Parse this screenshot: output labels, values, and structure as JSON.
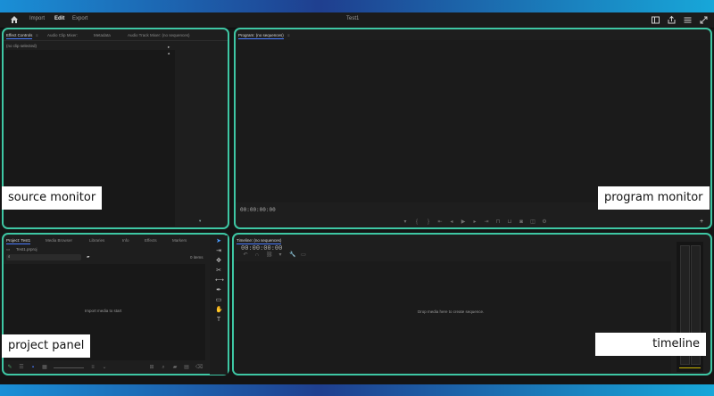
{
  "menubar": {
    "items": [
      {
        "label": "Import",
        "active": false
      },
      {
        "label": "Edit",
        "active": true
      },
      {
        "label": "Export",
        "active": false
      }
    ],
    "title": "Test1"
  },
  "source_panel": {
    "tabs": [
      "Effect Controls",
      "Audio Clip Mixer:",
      "Metadata",
      "Audio Track Mixer: (no sequences)"
    ],
    "no_clip": "(no clip selected)"
  },
  "program_panel": {
    "title": "Program: (no sequences)",
    "timecode": "00:00:00:00"
  },
  "project_panel": {
    "tabs": [
      "Project: Test1",
      "Media Browser",
      "Libraries",
      "Info",
      "Effects",
      "Markers"
    ],
    "project_name": "Test1.prproj",
    "item_count": "0 items",
    "empty_message": "Import media to start"
  },
  "timeline_panel": {
    "title": "Timeline: (no sequences)",
    "timecode": "00:00:00:00",
    "empty_message": "Drop media here to create sequence."
  },
  "annotations": {
    "source": "source monitor",
    "program": "program monitor",
    "project": "project panel",
    "timeline": "timeline"
  },
  "colors": {
    "highlight": "#3ec7a4",
    "accent": "#4a7cff"
  }
}
